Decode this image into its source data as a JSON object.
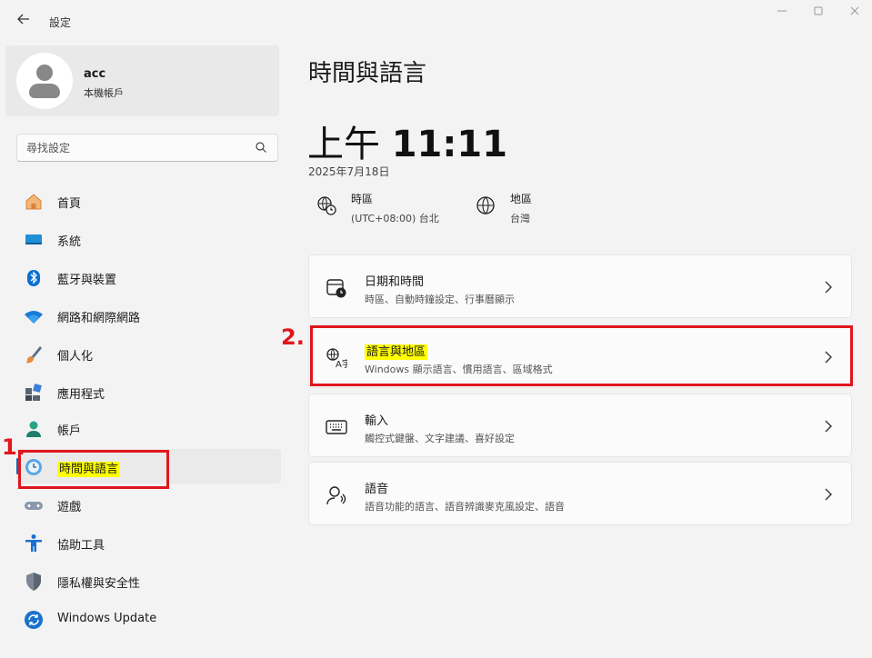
{
  "window": {
    "title": "設定",
    "controls": {
      "minimize": "—",
      "maximize": "☐",
      "close": "✕"
    }
  },
  "profile": {
    "name": "acc",
    "account_type": "本機帳戶"
  },
  "search": {
    "placeholder": "尋找設定"
  },
  "sidebar": {
    "items": [
      {
        "label": "首頁",
        "icon": "home-icon"
      },
      {
        "label": "系統",
        "icon": "system-icon"
      },
      {
        "label": "藍牙與裝置",
        "icon": "bluetooth-icon"
      },
      {
        "label": "網路和網際網路",
        "icon": "wifi-icon"
      },
      {
        "label": "個人化",
        "icon": "brush-icon"
      },
      {
        "label": "應用程式",
        "icon": "apps-icon"
      },
      {
        "label": "帳戶",
        "icon": "account-icon"
      },
      {
        "label": "時間與語言",
        "icon": "time-language-icon",
        "active": true
      },
      {
        "label": "遊戲",
        "icon": "gamepad-icon"
      },
      {
        "label": "協助工具",
        "icon": "accessibility-icon"
      },
      {
        "label": "隱私權與安全性",
        "icon": "shield-icon"
      },
      {
        "label": "Windows Update",
        "icon": "windows-update-icon"
      }
    ]
  },
  "main": {
    "title": "時間與語言",
    "clock": {
      "period": "上午",
      "time": "11:11"
    },
    "date": "2025年7月18日",
    "timezone": {
      "title": "時區",
      "value": "(UTC+08:00) 台北"
    },
    "region": {
      "title": "地區",
      "value": "台灣"
    },
    "cards": [
      {
        "title": "日期和時間",
        "subtitle": "時區、自動時鐘設定、行事曆顯示",
        "icon": "calendar-clock-icon"
      },
      {
        "title": "語言與地區",
        "subtitle": "Windows 顯示語言、慣用語言、區域格式",
        "icon": "language-icon"
      },
      {
        "title": "輸入",
        "subtitle": "觸控式鍵盤、文字建議、喜好設定",
        "icon": "keyboard-icon"
      },
      {
        "title": "語音",
        "subtitle": "語音功能的語言、語音辨識麥克風設定、語音",
        "icon": "speech-icon"
      }
    ]
  },
  "annotations": {
    "step1": "1.",
    "step2": "2."
  },
  "colors": {
    "accent": "#0067c0",
    "highlight": "#ffff00",
    "annotation": "#e0161c"
  }
}
